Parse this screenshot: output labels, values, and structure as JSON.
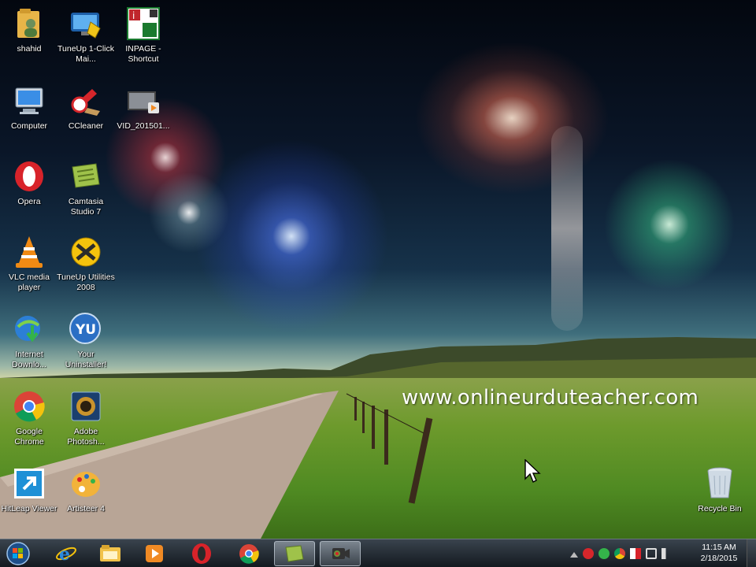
{
  "wallpaper": {
    "watermark": "www.onlineurduteacher.com"
  },
  "desktop_icons": [
    {
      "label": "shahid",
      "icon": "user-folder-icon"
    },
    {
      "label": "TuneUp 1-Click Mai...",
      "icon": "tuneup-1click-icon"
    },
    {
      "label": "INPAGE - Shortcut",
      "icon": "inpage-icon"
    },
    {
      "label": "Computer",
      "icon": "computer-icon"
    },
    {
      "label": "CCleaner",
      "icon": "ccleaner-icon"
    },
    {
      "label": "VID_201501...",
      "icon": "video-file-icon"
    },
    {
      "label": "Opera",
      "icon": "opera-icon"
    },
    {
      "label": "Camtasia Studio 7",
      "icon": "camtasia-icon"
    },
    {
      "label": "VLC media player",
      "icon": "vlc-icon"
    },
    {
      "label": "TuneUp Utilities 2008",
      "icon": "tuneup-utilities-icon"
    },
    {
      "label": "Internet Downlo...",
      "icon": "idm-icon"
    },
    {
      "label": "Your Uninstaller!",
      "icon": "uninstaller-icon"
    },
    {
      "label": "Google Chrome",
      "icon": "chrome-icon"
    },
    {
      "label": "Adobe Photosh...",
      "icon": "photoshop-icon"
    },
    {
      "label": "HitLeap Viewer",
      "icon": "hitleap-icon"
    },
    {
      "label": "Artisteer 4",
      "icon": "artisteer-icon"
    },
    {
      "label": "Recycle Bin",
      "icon": "recycle-bin-icon"
    }
  ],
  "taskbar": {
    "pinned": [
      {
        "name": "internet-explorer",
        "icon": "ie-icon"
      },
      {
        "name": "windows-explorer",
        "icon": "folder-icon"
      },
      {
        "name": "media-player",
        "icon": "media-player-icon"
      },
      {
        "name": "opera",
        "icon": "opera-icon"
      },
      {
        "name": "chrome",
        "icon": "chrome-icon"
      },
      {
        "name": "camtasia",
        "icon": "camtasia-icon"
      },
      {
        "name": "camtasia-recorder",
        "icon": "recorder-icon"
      }
    ],
    "clock": {
      "time": "11:15 AM",
      "date": "2/18/2015"
    }
  },
  "colors": {
    "accent_opera": "#d8232a",
    "chrome_red": "#db4437",
    "chrome_yellow": "#f4c20d",
    "chrome_green": "#0f9d58",
    "chrome_blue": "#4285f4",
    "folder_yellow": "#f1c24a"
  }
}
